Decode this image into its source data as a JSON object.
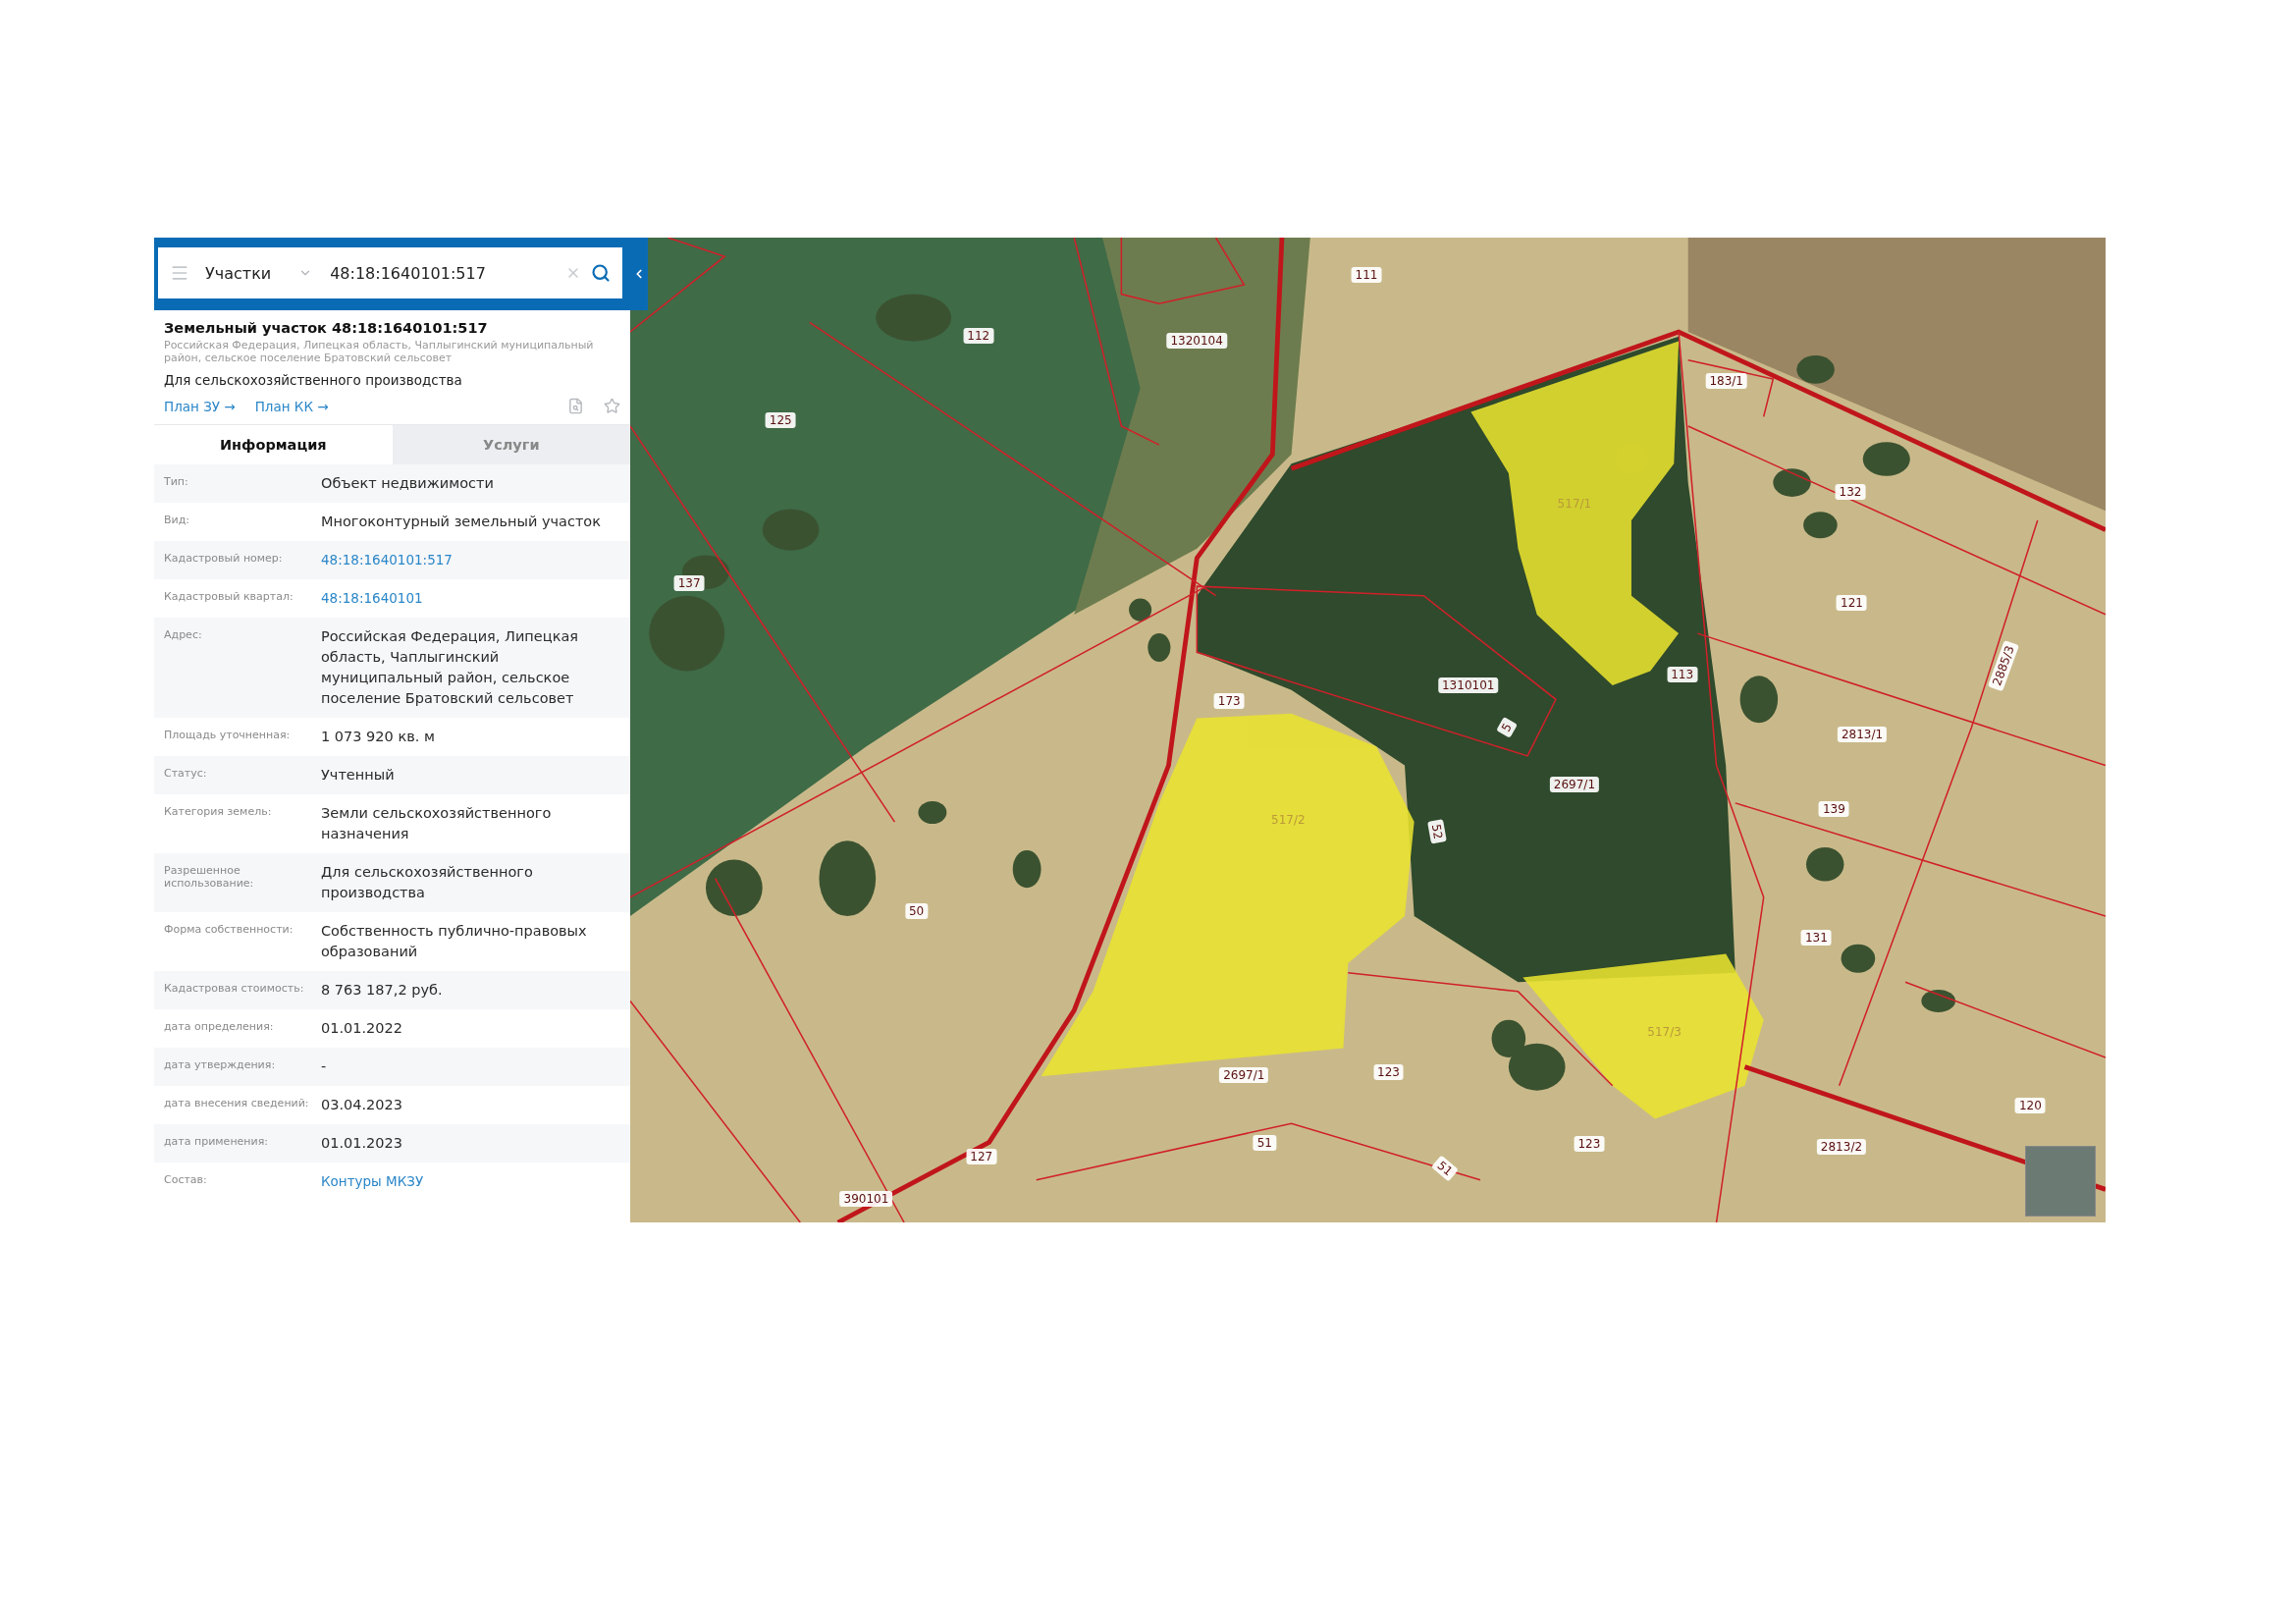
{
  "search": {
    "layer": "Участки",
    "value": "48:18:1640101:517"
  },
  "object": {
    "title": "Земельный участок 48:18:1640101:517",
    "address": "Российская Федерация, Липецкая область, Чаплыгинский муниципальный район, сельское поселение Братовский сельсовет",
    "purpose": "Для сельскохозяйственного производства",
    "links": [
      "План ЗУ →",
      "План КК →"
    ]
  },
  "tabs": [
    {
      "label": "Информация",
      "selected": true
    },
    {
      "label": "Услуги",
      "selected": false
    }
  ],
  "properties": [
    {
      "label": "Тип:",
      "value": "Объект недвижимости",
      "kind": "text"
    },
    {
      "label": "Вид:",
      "value": "Многоконтурный земельный участок",
      "kind": "text"
    },
    {
      "label": "Кадастровый номер:",
      "value": "48:18:1640101:517",
      "kind": "link"
    },
    {
      "label": "Кадастровый квартал:",
      "value": "48:18:1640101",
      "kind": "link"
    },
    {
      "label": "Адрес:",
      "value": "Российская Федерация, Липецкая область, Чаплыгинский муниципальный район, сельское поселение Братовский сельсовет",
      "kind": "text"
    },
    {
      "label": "Площадь уточненная:",
      "value": "1 073 920 кв. м",
      "kind": "text"
    },
    {
      "label": "Статус:",
      "value": "Учтенный",
      "kind": "text"
    },
    {
      "label": "Категория земель:",
      "value": "Земли сельскохозяйственного назначения",
      "kind": "text"
    },
    {
      "label": "Разрешенное использование:",
      "value": "Для сельскохозяйственного производства",
      "kind": "text"
    },
    {
      "label": "Форма собственности:",
      "value": "Собственность публично-правовых образований",
      "kind": "text"
    },
    {
      "label": "Кадастровая стоимость:",
      "value": "8 763 187,2 руб.",
      "kind": "text"
    },
    {
      "label": "дата определения:",
      "value": "01.01.2022",
      "kind": "text"
    },
    {
      "label": "дата утверждения:",
      "value": "-",
      "kind": "text"
    },
    {
      "label": "дата внесения сведений:",
      "value": "03.04.2023",
      "kind": "text"
    },
    {
      "label": "дата применения:",
      "value": "01.01.2023",
      "kind": "text"
    },
    {
      "label": "Состав:",
      "value": "Контуры МКЗУ",
      "kind": "link"
    }
  ],
  "map": {
    "labels": [
      {
        "text": "111",
        "highlighted": false
      },
      {
        "text": "112",
        "highlighted": false
      },
      {
        "text": "1320104",
        "highlighted": false
      },
      {
        "text": "125",
        "highlighted": false
      },
      {
        "text": "137",
        "highlighted": false
      },
      {
        "text": "183/1",
        "highlighted": false
      },
      {
        "text": "517/1",
        "highlighted": true
      },
      {
        "text": "132",
        "highlighted": false
      },
      {
        "text": "121",
        "highlighted": false
      },
      {
        "text": "2885/3",
        "highlighted": false
      },
      {
        "text": "113",
        "highlighted": false
      },
      {
        "text": "1310101",
        "highlighted": false
      },
      {
        "text": "173",
        "highlighted": false
      },
      {
        "text": "5",
        "highlighted": false
      },
      {
        "text": "2697/1",
        "highlighted": false
      },
      {
        "text": "2813/1",
        "highlighted": false
      },
      {
        "text": "139",
        "highlighted": false
      },
      {
        "text": "517/2",
        "highlighted": true
      },
      {
        "text": "52",
        "highlighted": false
      },
      {
        "text": "50",
        "highlighted": false
      },
      {
        "text": "131",
        "highlighted": false
      },
      {
        "text": "517/3",
        "highlighted": true
      },
      {
        "text": "2697/1",
        "highlighted": false
      },
      {
        "text": "123",
        "highlighted": false
      },
      {
        "text": "120",
        "highlighted": false
      },
      {
        "text": "51",
        "highlighted": false
      },
      {
        "text": "123",
        "highlighted": false
      },
      {
        "text": "2813/2",
        "highlighted": false
      },
      {
        "text": "127",
        "highlighted": false
      },
      {
        "text": "51",
        "highlighted": false
      },
      {
        "text": "390101",
        "highlighted": false
      }
    ]
  }
}
